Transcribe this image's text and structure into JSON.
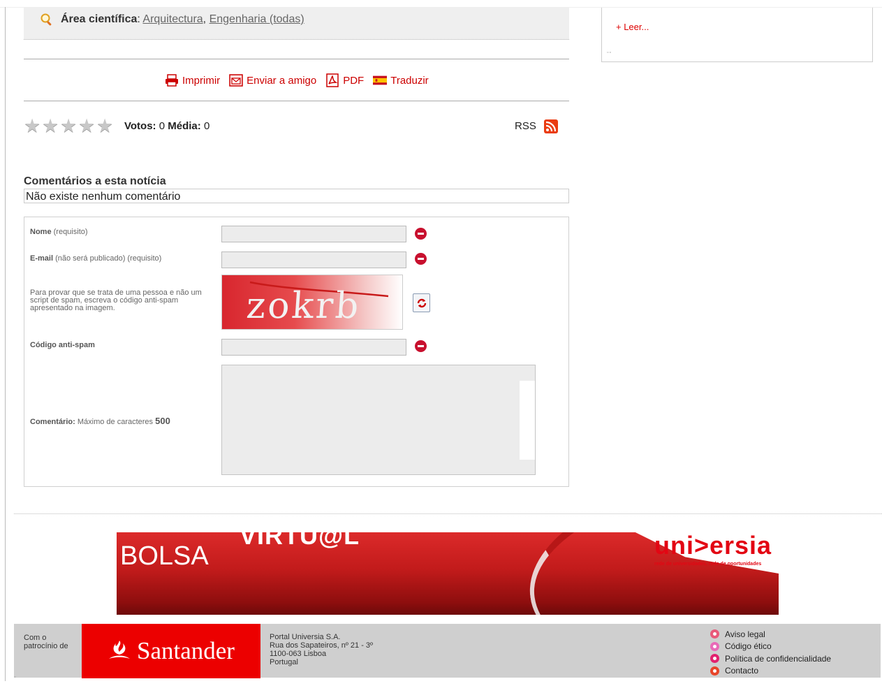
{
  "area": {
    "label": "Área científica",
    "separator": ":",
    "link1": "Arquitectura",
    "comma": ",",
    "link2": "Engenharia (todas)"
  },
  "toolbar": {
    "print": "Imprimir",
    "send": "Enviar a amigo",
    "pdf": "PDF",
    "translate": "Traduzir"
  },
  "rating": {
    "stars": 0,
    "votes_label": "Votos:",
    "votes_value": "0",
    "average_label": "Média:",
    "average_value": "0"
  },
  "rss": {
    "label": "RSS"
  },
  "comments": {
    "title": "Comentários a esta notícia",
    "empty": "Não existe nenhum comentário"
  },
  "form": {
    "name_label": "Nome",
    "name_hint": "(requisito)",
    "email_label": "E-mail",
    "email_hint": "(não será publicado) (requisito)",
    "captcha_instructions": "Para provar que se trata de uma pessoa e não um script de spam, escreva o código anti-spam apresentado na imagem.",
    "captcha_text": "zokrb",
    "code_label": "Código anti-spam",
    "comment_label": "Comentário:",
    "comment_hint": "Máximo de caracteres",
    "comment_max": "500"
  },
  "banner": {
    "word1": "VIRTU@L",
    "word2": "BOLSA",
    "brand": "uni>ersia",
    "tagline": "rede de universidades, rede de oportunidades"
  },
  "footer": {
    "sponsor_label": "Com o patrocínio de",
    "sponsor_name": "Santander",
    "address": [
      "Portal Universia S.A.",
      "Rua dos Sapateiros, nº 21 - 3º",
      "1100-063 Lisboa",
      "Portugal"
    ],
    "links": [
      {
        "label": "Aviso legal",
        "color": "#e85a7a"
      },
      {
        "label": "Código ético",
        "color": "#e86ab8"
      },
      {
        "label": "Política de confidencialidade",
        "color": "#e2226e"
      },
      {
        "label": "Contacto",
        "color": "#e8452a"
      }
    ]
  },
  "sidebar": {
    "read_more": "+ Leer..."
  },
  "colors": {
    "accent": "#cc0000",
    "santander": "#ec0000",
    "form_icon": "#c8102e"
  }
}
